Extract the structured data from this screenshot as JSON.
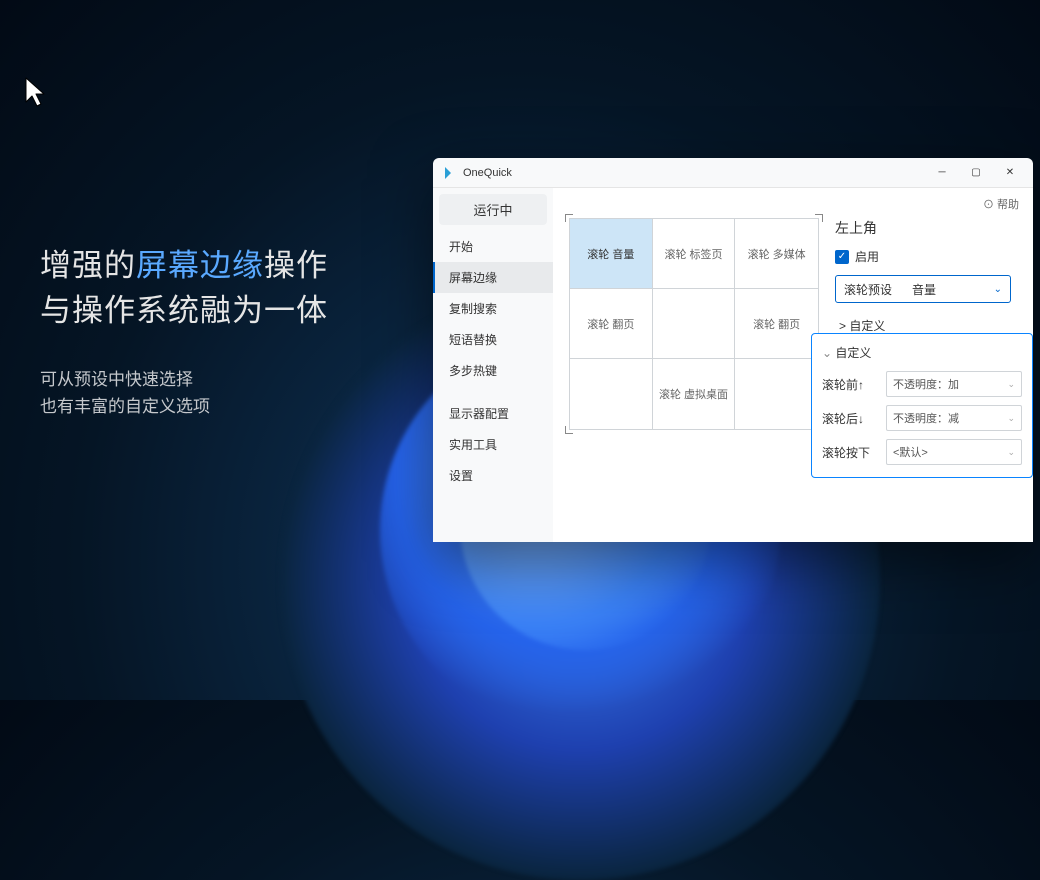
{
  "hero": {
    "line1_a": "增强的",
    "line1_b": "屏幕边缘",
    "line1_c": "操作",
    "line2": "与操作系统融为一体",
    "sub1": "可从预设中快速选择",
    "sub2": "也有丰富的自定义选项"
  },
  "window": {
    "title": "OneQuick",
    "help": "⊙ 帮助"
  },
  "sidebar": {
    "running": "运行中",
    "items": [
      "开始",
      "屏幕边缘",
      "复制搜索",
      "短语替换",
      "多步热键"
    ],
    "lower": [
      "显示器配置",
      "实用工具",
      "设置"
    ]
  },
  "grid": {
    "cells": [
      "滚轮 音量",
      "滚轮 标签页",
      "滚轮 多媒体",
      "滚轮 翻页",
      "",
      "滚轮 翻页",
      "",
      "滚轮 虚拟桌面",
      ""
    ]
  },
  "panel": {
    "title": "左上角",
    "enable": "启用",
    "preset_label": "滚轮预设",
    "preset_value": "音量",
    "custom": "> 自定义"
  },
  "popup": {
    "title": "自定义",
    "rows": [
      {
        "label": "滚轮前↑",
        "value": "不透明度：加"
      },
      {
        "label": "滚轮后↓",
        "value": "不透明度：减"
      },
      {
        "label": "滚轮按下",
        "value": "<默认>"
      }
    ]
  }
}
